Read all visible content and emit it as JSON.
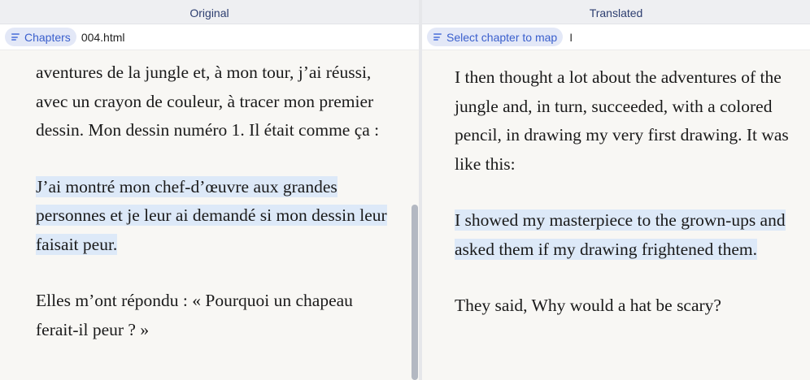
{
  "left_pane": {
    "header": "Original",
    "chapters_chip": "Chapters",
    "file_name": "004.html",
    "paragraphs": [
      {
        "text": "aventures de la jungle et, à mon tour, j’ai réussi, avec un crayon de couleur, à tracer mon premier dessin. Mon dessin numéro 1. Il était comme ça :",
        "highlighted": false
      },
      {
        "text": "J’ai montré mon chef-d’œuvre aux grandes personnes et je leur ai demandé si mon dessin leur faisait peur.",
        "highlighted": true
      },
      {
        "text": "Elles m’ont répondu : « Pourquoi un chapeau ferait-il peur ? »",
        "highlighted": false
      }
    ]
  },
  "right_pane": {
    "header": "Translated",
    "select_chip": "Select chapter to map",
    "cursor": "I",
    "paragraphs": [
      {
        "text": "I then thought a lot about the adventures of the jungle and, in turn, succeeded, with a colored pencil, in drawing my very first drawing. It was like this:",
        "highlighted": false
      },
      {
        "text": "I showed my masterpiece to the grown-ups and asked them if my drawing frightened them.",
        "highlighted": true
      },
      {
        "text": "They said, Why would a hat be scary?",
        "highlighted": false
      }
    ]
  },
  "colors": {
    "highlight": "#dde9f8",
    "chip_bg": "#e3e8f7",
    "chip_text": "#3a5fcd",
    "header_text": "#2d3e70"
  },
  "icons": {
    "chip_icon": "list-icon"
  }
}
